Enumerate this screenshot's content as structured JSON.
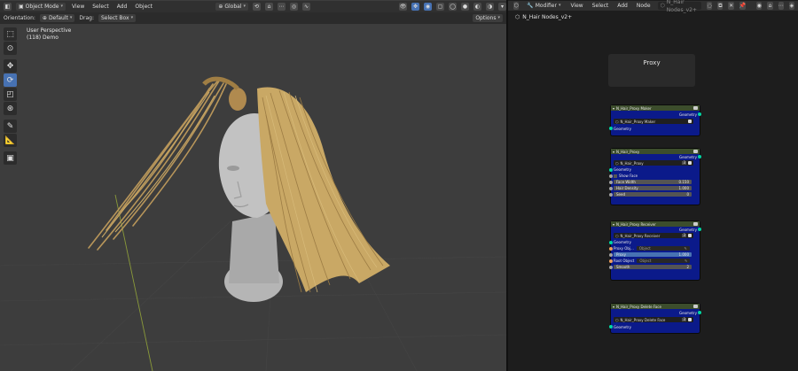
{
  "viewport": {
    "header": {
      "mode": "Object Mode",
      "menus": [
        "View",
        "Select",
        "Add",
        "Object"
      ],
      "transform_orientation": "Global"
    },
    "header2": {
      "orientation_label": "Orientation:",
      "orientation_value": "Default",
      "drag_label": "Drag:",
      "drag_value": "Select Box",
      "options_label": "Options"
    },
    "overlay": {
      "line1": "User Perspective",
      "line2": "(118) Demo"
    },
    "colors": {
      "background": "#3d3d3d",
      "head": "#bdbdbd",
      "hair": "#c7a565",
      "axis_y": "#8a9a3a",
      "active_tool": "#4772b3"
    },
    "tools": [
      "select-box",
      "cursor",
      "move",
      "rotate",
      "scale",
      "transform",
      "annotate",
      "measure",
      "add-cube"
    ]
  },
  "node_editor": {
    "header": {
      "editor_type": "Modifier",
      "menus": [
        "View",
        "Select",
        "Add",
        "Node"
      ],
      "node_group": "N_Hair Nodes_v2+"
    },
    "breadcrumb": "N_Hair Nodes_v2+",
    "frame_label": "Proxy",
    "nodes": [
      {
        "title": "N_Hair_Proxy Maker",
        "output": "Geometry",
        "group": "N_Hair_Proxy Maker",
        "input": "Geometry"
      },
      {
        "title": "N_Hair_Proxy",
        "output": "Geometry",
        "group": "N_Hair_Proxy",
        "group_count": "3",
        "input": "Geometry",
        "checkbox_label": "Show Face",
        "fields": [
          {
            "label": "Face Width",
            "value": "0.150"
          },
          {
            "label": "Hair Density",
            "value": "1.000"
          },
          {
            "label": "Seed",
            "value": "0"
          }
        ]
      },
      {
        "title": "N_Hair_Proxy Receiver",
        "output": "Geometry",
        "group": "N_Hair_Proxy Receiver",
        "group_count": "3",
        "input": "Geometry",
        "proxy_obj_label": "Proxy Obj...",
        "proxy_obj_value": "Object",
        "blue_field_label": "Proxy",
        "blue_field_value": "1.000",
        "root_obj_label": "Root Object",
        "root_obj_value": "Object",
        "smooth_label": "Smooth",
        "smooth_value": "2"
      },
      {
        "title": "N_Hair_Proxy Delete Face",
        "output": "Geometry",
        "group": "N_Hair_Proxy Delete Face",
        "group_count": "3",
        "input": "Geometry"
      }
    ]
  }
}
